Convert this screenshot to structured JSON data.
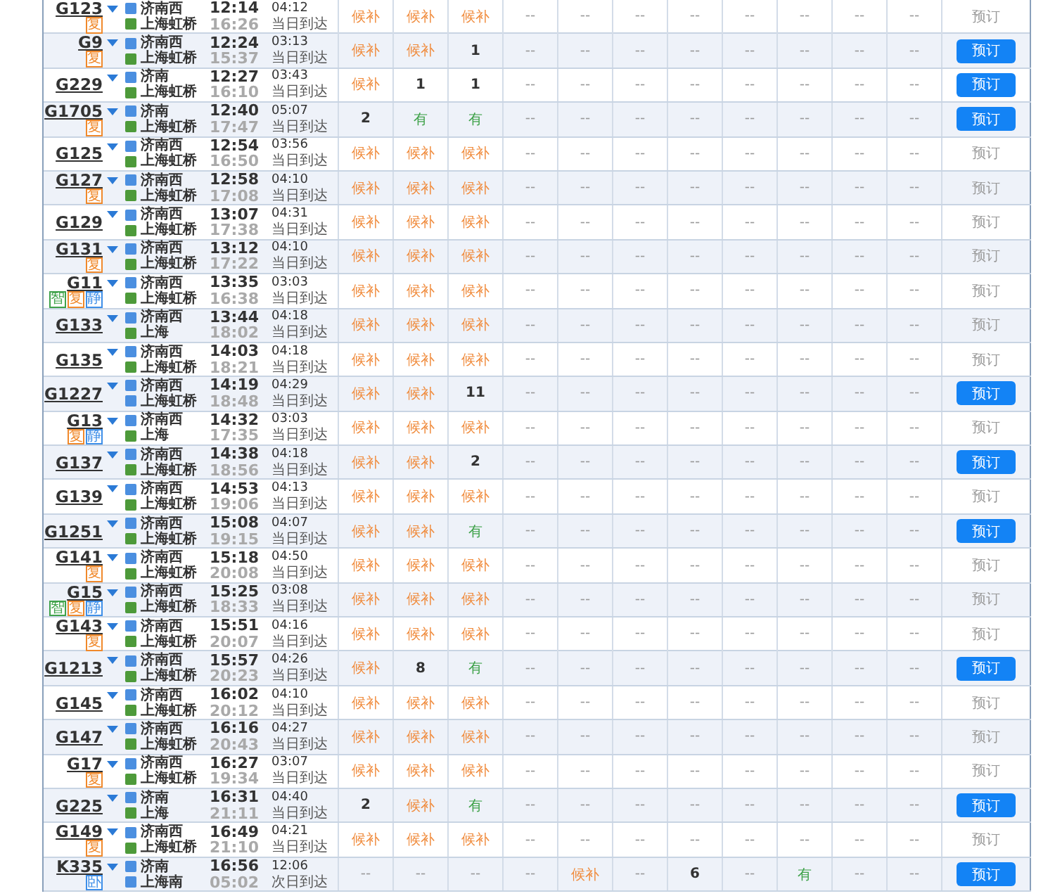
{
  "trains": [
    {
      "number": "G123",
      "badges": [
        {
          "text": "复",
          "color": "#f0892b"
        }
      ],
      "from": {
        "name": "济南西",
        "kind": "pass"
      },
      "to": {
        "name": "上海虹桥",
        "kind": "end"
      },
      "depart": "12:14",
      "arrive": "16:26",
      "duration": "04:12",
      "arrival_day": "当日到达",
      "seats": [
        {
          "text": "候补",
          "kind": "waitlist"
        },
        {
          "text": "候补",
          "kind": "waitlist"
        },
        {
          "text": "候补",
          "kind": "waitlist"
        },
        {
          "text": "--",
          "kind": "none"
        },
        {
          "text": "--",
          "kind": "none"
        },
        {
          "text": "--",
          "kind": "none"
        },
        {
          "text": "--",
          "kind": "none"
        },
        {
          "text": "--",
          "kind": "none"
        },
        {
          "text": "--",
          "kind": "none"
        },
        {
          "text": "--",
          "kind": "none"
        },
        {
          "text": "--",
          "kind": "none"
        }
      ],
      "booking": {
        "label": "预订",
        "disabled": true
      }
    },
    {
      "number": "G9",
      "badges": [
        {
          "text": "复",
          "color": "#f0892b"
        }
      ],
      "from": {
        "name": "济南西",
        "kind": "pass"
      },
      "to": {
        "name": "上海虹桥",
        "kind": "end"
      },
      "depart": "12:24",
      "arrive": "15:37",
      "duration": "03:13",
      "arrival_day": "当日到达",
      "seats": [
        {
          "text": "候补",
          "kind": "waitlist"
        },
        {
          "text": "候补",
          "kind": "waitlist"
        },
        {
          "text": "1",
          "kind": "count"
        },
        {
          "text": "--",
          "kind": "none"
        },
        {
          "text": "--",
          "kind": "none"
        },
        {
          "text": "--",
          "kind": "none"
        },
        {
          "text": "--",
          "kind": "none"
        },
        {
          "text": "--",
          "kind": "none"
        },
        {
          "text": "--",
          "kind": "none"
        },
        {
          "text": "--",
          "kind": "none"
        },
        {
          "text": "--",
          "kind": "none"
        }
      ],
      "booking": {
        "label": "预订",
        "disabled": false
      }
    },
    {
      "number": "G229",
      "from": {
        "name": "济南",
        "kind": "pass"
      },
      "to": {
        "name": "上海虹桥",
        "kind": "end"
      },
      "depart": "12:27",
      "arrive": "16:10",
      "duration": "03:43",
      "arrival_day": "当日到达",
      "seats": [
        {
          "text": "候补",
          "kind": "waitlist"
        },
        {
          "text": "1",
          "kind": "count"
        },
        {
          "text": "1",
          "kind": "count"
        },
        {
          "text": "--",
          "kind": "none"
        },
        {
          "text": "--",
          "kind": "none"
        },
        {
          "text": "--",
          "kind": "none"
        },
        {
          "text": "--",
          "kind": "none"
        },
        {
          "text": "--",
          "kind": "none"
        },
        {
          "text": "--",
          "kind": "none"
        },
        {
          "text": "--",
          "kind": "none"
        },
        {
          "text": "--",
          "kind": "none"
        }
      ],
      "booking": {
        "label": "预订",
        "disabled": false
      }
    },
    {
      "number": "G1705",
      "badges": [
        {
          "text": "复",
          "color": "#f0892b"
        }
      ],
      "from": {
        "name": "济南",
        "kind": "pass"
      },
      "to": {
        "name": "上海虹桥",
        "kind": "end"
      },
      "depart": "12:40",
      "arrive": "17:47",
      "duration": "05:07",
      "arrival_day": "当日到达",
      "seats": [
        {
          "text": "2",
          "kind": "count"
        },
        {
          "text": "有",
          "kind": "available"
        },
        {
          "text": "有",
          "kind": "available"
        },
        {
          "text": "--",
          "kind": "none"
        },
        {
          "text": "--",
          "kind": "none"
        },
        {
          "text": "--",
          "kind": "none"
        },
        {
          "text": "--",
          "kind": "none"
        },
        {
          "text": "--",
          "kind": "none"
        },
        {
          "text": "--",
          "kind": "none"
        },
        {
          "text": "--",
          "kind": "none"
        },
        {
          "text": "--",
          "kind": "none"
        }
      ],
      "booking": {
        "label": "预订",
        "disabled": false
      }
    },
    {
      "number": "G125",
      "from": {
        "name": "济南西",
        "kind": "pass"
      },
      "to": {
        "name": "上海虹桥",
        "kind": "end"
      },
      "depart": "12:54",
      "arrive": "16:50",
      "duration": "03:56",
      "arrival_day": "当日到达",
      "seats": [
        {
          "text": "候补",
          "kind": "waitlist"
        },
        {
          "text": "候补",
          "kind": "waitlist"
        },
        {
          "text": "候补",
          "kind": "waitlist"
        },
        {
          "text": "--",
          "kind": "none"
        },
        {
          "text": "--",
          "kind": "none"
        },
        {
          "text": "--",
          "kind": "none"
        },
        {
          "text": "--",
          "kind": "none"
        },
        {
          "text": "--",
          "kind": "none"
        },
        {
          "text": "--",
          "kind": "none"
        },
        {
          "text": "--",
          "kind": "none"
        },
        {
          "text": "--",
          "kind": "none"
        }
      ],
      "booking": {
        "label": "预订",
        "disabled": true
      }
    },
    {
      "number": "G127",
      "badges": [
        {
          "text": "复",
          "color": "#f0892b"
        }
      ],
      "from": {
        "name": "济南西",
        "kind": "pass"
      },
      "to": {
        "name": "上海虹桥",
        "kind": "end"
      },
      "depart": "12:58",
      "arrive": "17:08",
      "duration": "04:10",
      "arrival_day": "当日到达",
      "seats": [
        {
          "text": "候补",
          "kind": "waitlist"
        },
        {
          "text": "候补",
          "kind": "waitlist"
        },
        {
          "text": "候补",
          "kind": "waitlist"
        },
        {
          "text": "--",
          "kind": "none"
        },
        {
          "text": "--",
          "kind": "none"
        },
        {
          "text": "--",
          "kind": "none"
        },
        {
          "text": "--",
          "kind": "none"
        },
        {
          "text": "--",
          "kind": "none"
        },
        {
          "text": "--",
          "kind": "none"
        },
        {
          "text": "--",
          "kind": "none"
        },
        {
          "text": "--",
          "kind": "none"
        }
      ],
      "booking": {
        "label": "预订",
        "disabled": true
      }
    },
    {
      "number": "G129",
      "from": {
        "name": "济南西",
        "kind": "pass"
      },
      "to": {
        "name": "上海虹桥",
        "kind": "end"
      },
      "depart": "13:07",
      "arrive": "17:38",
      "duration": "04:31",
      "arrival_day": "当日到达",
      "seats": [
        {
          "text": "候补",
          "kind": "waitlist"
        },
        {
          "text": "候补",
          "kind": "waitlist"
        },
        {
          "text": "候补",
          "kind": "waitlist"
        },
        {
          "text": "--",
          "kind": "none"
        },
        {
          "text": "--",
          "kind": "none"
        },
        {
          "text": "--",
          "kind": "none"
        },
        {
          "text": "--",
          "kind": "none"
        },
        {
          "text": "--",
          "kind": "none"
        },
        {
          "text": "--",
          "kind": "none"
        },
        {
          "text": "--",
          "kind": "none"
        },
        {
          "text": "--",
          "kind": "none"
        }
      ],
      "booking": {
        "label": "预订",
        "disabled": true
      }
    },
    {
      "number": "G131",
      "badges": [
        {
          "text": "复",
          "color": "#f0892b"
        }
      ],
      "from": {
        "name": "济南西",
        "kind": "pass"
      },
      "to": {
        "name": "上海虹桥",
        "kind": "end"
      },
      "depart": "13:12",
      "arrive": "17:22",
      "duration": "04:10",
      "arrival_day": "当日到达",
      "seats": [
        {
          "text": "候补",
          "kind": "waitlist"
        },
        {
          "text": "候补",
          "kind": "waitlist"
        },
        {
          "text": "候补",
          "kind": "waitlist"
        },
        {
          "text": "--",
          "kind": "none"
        },
        {
          "text": "--",
          "kind": "none"
        },
        {
          "text": "--",
          "kind": "none"
        },
        {
          "text": "--",
          "kind": "none"
        },
        {
          "text": "--",
          "kind": "none"
        },
        {
          "text": "--",
          "kind": "none"
        },
        {
          "text": "--",
          "kind": "none"
        },
        {
          "text": "--",
          "kind": "none"
        }
      ],
      "booking": {
        "label": "预订",
        "disabled": true
      }
    },
    {
      "number": "G11",
      "badges": [
        {
          "text": "智",
          "color": "#3fa24a"
        },
        {
          "text": "复",
          "color": "#f0892b"
        },
        {
          "text": "静",
          "color": "#3d8ee8"
        }
      ],
      "from": {
        "name": "济南西",
        "kind": "pass"
      },
      "to": {
        "name": "上海虹桥",
        "kind": "end"
      },
      "depart": "13:35",
      "arrive": "16:38",
      "duration": "03:03",
      "arrival_day": "当日到达",
      "seats": [
        {
          "text": "候补",
          "kind": "waitlist"
        },
        {
          "text": "候补",
          "kind": "waitlist"
        },
        {
          "text": "候补",
          "kind": "waitlist"
        },
        {
          "text": "--",
          "kind": "none"
        },
        {
          "text": "--",
          "kind": "none"
        },
        {
          "text": "--",
          "kind": "none"
        },
        {
          "text": "--",
          "kind": "none"
        },
        {
          "text": "--",
          "kind": "none"
        },
        {
          "text": "--",
          "kind": "none"
        },
        {
          "text": "--",
          "kind": "none"
        },
        {
          "text": "--",
          "kind": "none"
        }
      ],
      "booking": {
        "label": "预订",
        "disabled": true
      }
    },
    {
      "number": "G133",
      "from": {
        "name": "济南西",
        "kind": "pass"
      },
      "to": {
        "name": "上海",
        "kind": "end"
      },
      "depart": "13:44",
      "arrive": "18:02",
      "duration": "04:18",
      "arrival_day": "当日到达",
      "seats": [
        {
          "text": "候补",
          "kind": "waitlist"
        },
        {
          "text": "候补",
          "kind": "waitlist"
        },
        {
          "text": "候补",
          "kind": "waitlist"
        },
        {
          "text": "--",
          "kind": "none"
        },
        {
          "text": "--",
          "kind": "none"
        },
        {
          "text": "--",
          "kind": "none"
        },
        {
          "text": "--",
          "kind": "none"
        },
        {
          "text": "--",
          "kind": "none"
        },
        {
          "text": "--",
          "kind": "none"
        },
        {
          "text": "--",
          "kind": "none"
        },
        {
          "text": "--",
          "kind": "none"
        }
      ],
      "booking": {
        "label": "预订",
        "disabled": true
      }
    },
    {
      "number": "G135",
      "from": {
        "name": "济南西",
        "kind": "pass"
      },
      "to": {
        "name": "上海虹桥",
        "kind": "end"
      },
      "depart": "14:03",
      "arrive": "18:21",
      "duration": "04:18",
      "arrival_day": "当日到达",
      "seats": [
        {
          "text": "候补",
          "kind": "waitlist"
        },
        {
          "text": "候补",
          "kind": "waitlist"
        },
        {
          "text": "候补",
          "kind": "waitlist"
        },
        {
          "text": "--",
          "kind": "none"
        },
        {
          "text": "--",
          "kind": "none"
        },
        {
          "text": "--",
          "kind": "none"
        },
        {
          "text": "--",
          "kind": "none"
        },
        {
          "text": "--",
          "kind": "none"
        },
        {
          "text": "--",
          "kind": "none"
        },
        {
          "text": "--",
          "kind": "none"
        },
        {
          "text": "--",
          "kind": "none"
        }
      ],
      "booking": {
        "label": "预订",
        "disabled": true
      }
    },
    {
      "number": "G1227",
      "from": {
        "name": "济南西",
        "kind": "pass"
      },
      "to": {
        "name": "上海虹桥",
        "kind": "pass"
      },
      "depart": "14:19",
      "arrive": "18:48",
      "duration": "04:29",
      "arrival_day": "当日到达",
      "seats": [
        {
          "text": "候补",
          "kind": "waitlist"
        },
        {
          "text": "候补",
          "kind": "waitlist"
        },
        {
          "text": "11",
          "kind": "count"
        },
        {
          "text": "--",
          "kind": "none"
        },
        {
          "text": "--",
          "kind": "none"
        },
        {
          "text": "--",
          "kind": "none"
        },
        {
          "text": "--",
          "kind": "none"
        },
        {
          "text": "--",
          "kind": "none"
        },
        {
          "text": "--",
          "kind": "none"
        },
        {
          "text": "--",
          "kind": "none"
        },
        {
          "text": "--",
          "kind": "none"
        }
      ],
      "booking": {
        "label": "预订",
        "disabled": false
      }
    },
    {
      "number": "G13",
      "badges": [
        {
          "text": "复",
          "color": "#f0892b"
        },
        {
          "text": "静",
          "color": "#3d8ee8"
        }
      ],
      "from": {
        "name": "济南西",
        "kind": "pass"
      },
      "to": {
        "name": "上海",
        "kind": "end"
      },
      "depart": "14:32",
      "arrive": "17:35",
      "duration": "03:03",
      "arrival_day": "当日到达",
      "seats": [
        {
          "text": "候补",
          "kind": "waitlist"
        },
        {
          "text": "候补",
          "kind": "waitlist"
        },
        {
          "text": "候补",
          "kind": "waitlist"
        },
        {
          "text": "--",
          "kind": "none"
        },
        {
          "text": "--",
          "kind": "none"
        },
        {
          "text": "--",
          "kind": "none"
        },
        {
          "text": "--",
          "kind": "none"
        },
        {
          "text": "--",
          "kind": "none"
        },
        {
          "text": "--",
          "kind": "none"
        },
        {
          "text": "--",
          "kind": "none"
        },
        {
          "text": "--",
          "kind": "none"
        }
      ],
      "booking": {
        "label": "预订",
        "disabled": true
      }
    },
    {
      "number": "G137",
      "from": {
        "name": "济南西",
        "kind": "pass"
      },
      "to": {
        "name": "上海虹桥",
        "kind": "end"
      },
      "depart": "14:38",
      "arrive": "18:56",
      "duration": "04:18",
      "arrival_day": "当日到达",
      "seats": [
        {
          "text": "候补",
          "kind": "waitlist"
        },
        {
          "text": "候补",
          "kind": "waitlist"
        },
        {
          "text": "2",
          "kind": "count"
        },
        {
          "text": "--",
          "kind": "none"
        },
        {
          "text": "--",
          "kind": "none"
        },
        {
          "text": "--",
          "kind": "none"
        },
        {
          "text": "--",
          "kind": "none"
        },
        {
          "text": "--",
          "kind": "none"
        },
        {
          "text": "--",
          "kind": "none"
        },
        {
          "text": "--",
          "kind": "none"
        },
        {
          "text": "--",
          "kind": "none"
        }
      ],
      "booking": {
        "label": "预订",
        "disabled": false
      }
    },
    {
      "number": "G139",
      "from": {
        "name": "济南西",
        "kind": "pass"
      },
      "to": {
        "name": "上海虹桥",
        "kind": "end"
      },
      "depart": "14:53",
      "arrive": "19:06",
      "duration": "04:13",
      "arrival_day": "当日到达",
      "seats": [
        {
          "text": "候补",
          "kind": "waitlist"
        },
        {
          "text": "候补",
          "kind": "waitlist"
        },
        {
          "text": "候补",
          "kind": "waitlist"
        },
        {
          "text": "--",
          "kind": "none"
        },
        {
          "text": "--",
          "kind": "none"
        },
        {
          "text": "--",
          "kind": "none"
        },
        {
          "text": "--",
          "kind": "none"
        },
        {
          "text": "--",
          "kind": "none"
        },
        {
          "text": "--",
          "kind": "none"
        },
        {
          "text": "--",
          "kind": "none"
        },
        {
          "text": "--",
          "kind": "none"
        }
      ],
      "booking": {
        "label": "预订",
        "disabled": true
      }
    },
    {
      "number": "G1251",
      "from": {
        "name": "济南西",
        "kind": "pass"
      },
      "to": {
        "name": "上海虹桥",
        "kind": "end"
      },
      "depart": "15:08",
      "arrive": "19:15",
      "duration": "04:07",
      "arrival_day": "当日到达",
      "seats": [
        {
          "text": "候补",
          "kind": "waitlist"
        },
        {
          "text": "候补",
          "kind": "waitlist"
        },
        {
          "text": "有",
          "kind": "available"
        },
        {
          "text": "--",
          "kind": "none"
        },
        {
          "text": "--",
          "kind": "none"
        },
        {
          "text": "--",
          "kind": "none"
        },
        {
          "text": "--",
          "kind": "none"
        },
        {
          "text": "--",
          "kind": "none"
        },
        {
          "text": "--",
          "kind": "none"
        },
        {
          "text": "--",
          "kind": "none"
        },
        {
          "text": "--",
          "kind": "none"
        }
      ],
      "booking": {
        "label": "预订",
        "disabled": false
      }
    },
    {
      "number": "G141",
      "badges": [
        {
          "text": "复",
          "color": "#f0892b"
        }
      ],
      "from": {
        "name": "济南西",
        "kind": "pass"
      },
      "to": {
        "name": "上海虹桥",
        "kind": "end"
      },
      "depart": "15:18",
      "arrive": "20:08",
      "duration": "04:50",
      "arrival_day": "当日到达",
      "seats": [
        {
          "text": "候补",
          "kind": "waitlist"
        },
        {
          "text": "候补",
          "kind": "waitlist"
        },
        {
          "text": "候补",
          "kind": "waitlist"
        },
        {
          "text": "--",
          "kind": "none"
        },
        {
          "text": "--",
          "kind": "none"
        },
        {
          "text": "--",
          "kind": "none"
        },
        {
          "text": "--",
          "kind": "none"
        },
        {
          "text": "--",
          "kind": "none"
        },
        {
          "text": "--",
          "kind": "none"
        },
        {
          "text": "--",
          "kind": "none"
        },
        {
          "text": "--",
          "kind": "none"
        }
      ],
      "booking": {
        "label": "预订",
        "disabled": true
      }
    },
    {
      "number": "G15",
      "badges": [
        {
          "text": "智",
          "color": "#3fa24a"
        },
        {
          "text": "复",
          "color": "#f0892b"
        },
        {
          "text": "静",
          "color": "#3d8ee8"
        }
      ],
      "from": {
        "name": "济南西",
        "kind": "pass"
      },
      "to": {
        "name": "上海虹桥",
        "kind": "end"
      },
      "depart": "15:25",
      "arrive": "18:33",
      "duration": "03:08",
      "arrival_day": "当日到达",
      "seats": [
        {
          "text": "候补",
          "kind": "waitlist"
        },
        {
          "text": "候补",
          "kind": "waitlist"
        },
        {
          "text": "候补",
          "kind": "waitlist"
        },
        {
          "text": "--",
          "kind": "none"
        },
        {
          "text": "--",
          "kind": "none"
        },
        {
          "text": "--",
          "kind": "none"
        },
        {
          "text": "--",
          "kind": "none"
        },
        {
          "text": "--",
          "kind": "none"
        },
        {
          "text": "--",
          "kind": "none"
        },
        {
          "text": "--",
          "kind": "none"
        },
        {
          "text": "--",
          "kind": "none"
        }
      ],
      "booking": {
        "label": "预订",
        "disabled": true
      }
    },
    {
      "number": "G143",
      "badges": [
        {
          "text": "复",
          "color": "#f0892b"
        }
      ],
      "from": {
        "name": "济南西",
        "kind": "pass"
      },
      "to": {
        "name": "上海虹桥",
        "kind": "end"
      },
      "depart": "15:51",
      "arrive": "20:07",
      "duration": "04:16",
      "arrival_day": "当日到达",
      "seats": [
        {
          "text": "候补",
          "kind": "waitlist"
        },
        {
          "text": "候补",
          "kind": "waitlist"
        },
        {
          "text": "候补",
          "kind": "waitlist"
        },
        {
          "text": "--",
          "kind": "none"
        },
        {
          "text": "--",
          "kind": "none"
        },
        {
          "text": "--",
          "kind": "none"
        },
        {
          "text": "--",
          "kind": "none"
        },
        {
          "text": "--",
          "kind": "none"
        },
        {
          "text": "--",
          "kind": "none"
        },
        {
          "text": "--",
          "kind": "none"
        },
        {
          "text": "--",
          "kind": "none"
        }
      ],
      "booking": {
        "label": "预订",
        "disabled": true
      }
    },
    {
      "number": "G1213",
      "from": {
        "name": "济南西",
        "kind": "pass"
      },
      "to": {
        "name": "上海虹桥",
        "kind": "end"
      },
      "depart": "15:57",
      "arrive": "20:23",
      "duration": "04:26",
      "arrival_day": "当日到达",
      "seats": [
        {
          "text": "候补",
          "kind": "waitlist"
        },
        {
          "text": "8",
          "kind": "count"
        },
        {
          "text": "有",
          "kind": "available"
        },
        {
          "text": "--",
          "kind": "none"
        },
        {
          "text": "--",
          "kind": "none"
        },
        {
          "text": "--",
          "kind": "none"
        },
        {
          "text": "--",
          "kind": "none"
        },
        {
          "text": "--",
          "kind": "none"
        },
        {
          "text": "--",
          "kind": "none"
        },
        {
          "text": "--",
          "kind": "none"
        },
        {
          "text": "--",
          "kind": "none"
        }
      ],
      "booking": {
        "label": "预订",
        "disabled": false
      }
    },
    {
      "number": "G145",
      "from": {
        "name": "济南西",
        "kind": "pass"
      },
      "to": {
        "name": "上海虹桥",
        "kind": "end"
      },
      "depart": "16:02",
      "arrive": "20:12",
      "duration": "04:10",
      "arrival_day": "当日到达",
      "seats": [
        {
          "text": "候补",
          "kind": "waitlist"
        },
        {
          "text": "候补",
          "kind": "waitlist"
        },
        {
          "text": "候补",
          "kind": "waitlist"
        },
        {
          "text": "--",
          "kind": "none"
        },
        {
          "text": "--",
          "kind": "none"
        },
        {
          "text": "--",
          "kind": "none"
        },
        {
          "text": "--",
          "kind": "none"
        },
        {
          "text": "--",
          "kind": "none"
        },
        {
          "text": "--",
          "kind": "none"
        },
        {
          "text": "--",
          "kind": "none"
        },
        {
          "text": "--",
          "kind": "none"
        }
      ],
      "booking": {
        "label": "预订",
        "disabled": true
      }
    },
    {
      "number": "G147",
      "from": {
        "name": "济南西",
        "kind": "pass"
      },
      "to": {
        "name": "上海虹桥",
        "kind": "end"
      },
      "depart": "16:16",
      "arrive": "20:43",
      "duration": "04:27",
      "arrival_day": "当日到达",
      "seats": [
        {
          "text": "候补",
          "kind": "waitlist"
        },
        {
          "text": "候补",
          "kind": "waitlist"
        },
        {
          "text": "候补",
          "kind": "waitlist"
        },
        {
          "text": "--",
          "kind": "none"
        },
        {
          "text": "--",
          "kind": "none"
        },
        {
          "text": "--",
          "kind": "none"
        },
        {
          "text": "--",
          "kind": "none"
        },
        {
          "text": "--",
          "kind": "none"
        },
        {
          "text": "--",
          "kind": "none"
        },
        {
          "text": "--",
          "kind": "none"
        },
        {
          "text": "--",
          "kind": "none"
        }
      ],
      "booking": {
        "label": "预订",
        "disabled": true
      }
    },
    {
      "number": "G17",
      "badges": [
        {
          "text": "复",
          "color": "#f0892b"
        }
      ],
      "from": {
        "name": "济南西",
        "kind": "pass"
      },
      "to": {
        "name": "上海虹桥",
        "kind": "end"
      },
      "depart": "16:27",
      "arrive": "19:34",
      "duration": "03:07",
      "arrival_day": "当日到达",
      "seats": [
        {
          "text": "候补",
          "kind": "waitlist"
        },
        {
          "text": "候补",
          "kind": "waitlist"
        },
        {
          "text": "候补",
          "kind": "waitlist"
        },
        {
          "text": "--",
          "kind": "none"
        },
        {
          "text": "--",
          "kind": "none"
        },
        {
          "text": "--",
          "kind": "none"
        },
        {
          "text": "--",
          "kind": "none"
        },
        {
          "text": "--",
          "kind": "none"
        },
        {
          "text": "--",
          "kind": "none"
        },
        {
          "text": "--",
          "kind": "none"
        },
        {
          "text": "--",
          "kind": "none"
        }
      ],
      "booking": {
        "label": "预订",
        "disabled": true
      }
    },
    {
      "number": "G225",
      "from": {
        "name": "济南",
        "kind": "pass"
      },
      "to": {
        "name": "上海",
        "kind": "end"
      },
      "depart": "16:31",
      "arrive": "21:11",
      "duration": "04:40",
      "arrival_day": "当日到达",
      "seats": [
        {
          "text": "2",
          "kind": "count"
        },
        {
          "text": "候补",
          "kind": "waitlist"
        },
        {
          "text": "有",
          "kind": "available"
        },
        {
          "text": "--",
          "kind": "none"
        },
        {
          "text": "--",
          "kind": "none"
        },
        {
          "text": "--",
          "kind": "none"
        },
        {
          "text": "--",
          "kind": "none"
        },
        {
          "text": "--",
          "kind": "none"
        },
        {
          "text": "--",
          "kind": "none"
        },
        {
          "text": "--",
          "kind": "none"
        },
        {
          "text": "--",
          "kind": "none"
        }
      ],
      "booking": {
        "label": "预订",
        "disabled": false
      }
    },
    {
      "number": "G149",
      "badges": [
        {
          "text": "复",
          "color": "#f0892b"
        }
      ],
      "from": {
        "name": "济南西",
        "kind": "pass"
      },
      "to": {
        "name": "上海虹桥",
        "kind": "end"
      },
      "depart": "16:49",
      "arrive": "21:10",
      "duration": "04:21",
      "arrival_day": "当日到达",
      "seats": [
        {
          "text": "候补",
          "kind": "waitlist"
        },
        {
          "text": "候补",
          "kind": "waitlist"
        },
        {
          "text": "候补",
          "kind": "waitlist"
        },
        {
          "text": "--",
          "kind": "none"
        },
        {
          "text": "--",
          "kind": "none"
        },
        {
          "text": "--",
          "kind": "none"
        },
        {
          "text": "--",
          "kind": "none"
        },
        {
          "text": "--",
          "kind": "none"
        },
        {
          "text": "--",
          "kind": "none"
        },
        {
          "text": "--",
          "kind": "none"
        },
        {
          "text": "--",
          "kind": "none"
        }
      ],
      "booking": {
        "label": "预订",
        "disabled": true
      }
    },
    {
      "number": "K335",
      "badges": [
        {
          "text": "卧",
          "color": "#3d8ee8"
        }
      ],
      "from": {
        "name": "济南",
        "kind": "pass"
      },
      "to": {
        "name": "上海南",
        "kind": "pass"
      },
      "depart": "16:56",
      "arrive": "05:02",
      "duration": "12:06",
      "arrival_day": "次日到达",
      "seats": [
        {
          "text": "--",
          "kind": "none"
        },
        {
          "text": "--",
          "kind": "none"
        },
        {
          "text": "--",
          "kind": "none"
        },
        {
          "text": "--",
          "kind": "none"
        },
        {
          "text": "候补",
          "kind": "waitlist"
        },
        {
          "text": "--",
          "kind": "none"
        },
        {
          "text": "6",
          "kind": "count"
        },
        {
          "text": "--",
          "kind": "none"
        },
        {
          "text": "有",
          "kind": "available"
        },
        {
          "text": "--",
          "kind": "none"
        },
        {
          "text": "--",
          "kind": "none"
        }
      ],
      "booking": {
        "label": "预订",
        "disabled": false
      }
    }
  ]
}
